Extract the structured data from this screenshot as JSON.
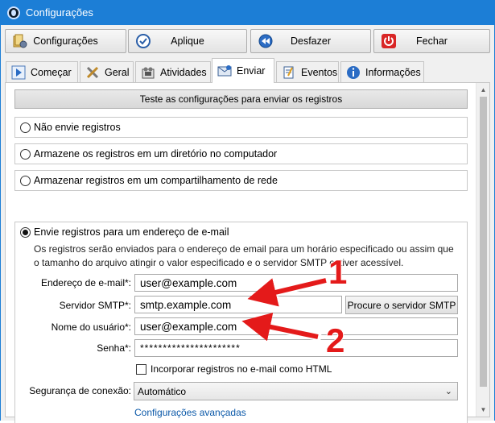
{
  "window": {
    "title": "Configurações"
  },
  "toolbar": {
    "settings_label": "Configurações",
    "apply_label": "Aplique",
    "undo_label": "Desfazer",
    "close_label": "Fechar"
  },
  "tabs": [
    {
      "label": "Começar",
      "icon": "play-icon"
    },
    {
      "label": "Geral",
      "icon": "tools-icon"
    },
    {
      "label": "Atividades",
      "icon": "activities-icon"
    },
    {
      "label": "Enviar",
      "icon": "mail-icon",
      "active": true
    },
    {
      "label": "Eventos",
      "icon": "notepad-icon"
    },
    {
      "label": "Informações",
      "icon": "info-icon"
    }
  ],
  "test_button": "Teste as configurações para enviar os registros",
  "options": {
    "no_send": "Não envie registros",
    "local_dir": "Armazene os registros em um diretório no computador",
    "network_share": "Armazenar registros em um compartilhamento de rede",
    "email": "Envie registros para um endereço de e-mail"
  },
  "email_section": {
    "description": "Os registros serão enviados para o endereço de email para um horário especificado ou assim que o tamanho do arquivo atingir o valor especificado e o servidor SMTP estiver acessível.",
    "email_label": "Endereço de e-mail*:",
    "email_value": "user@example.com",
    "smtp_label": "Servidor SMTP*:",
    "smtp_value": "smtp.example.com",
    "smtp_button": "Procure o servidor SMTP",
    "user_label": "Nome do usuário*:",
    "user_value": "user@example.com",
    "password_label": "Senha*:",
    "password_value": "**********************",
    "html_checkbox": "Incorporar registros no e-mail como HTML",
    "security_label": "Segurança de conexão:",
    "security_value": "Automático",
    "advanced_link": "Configurações avançadas"
  },
  "annotations": {
    "one": "1",
    "two": "2",
    "color": "#e41a1a"
  },
  "colors": {
    "titlebar": "#1c7ed6",
    "link": "#0a58a8"
  }
}
